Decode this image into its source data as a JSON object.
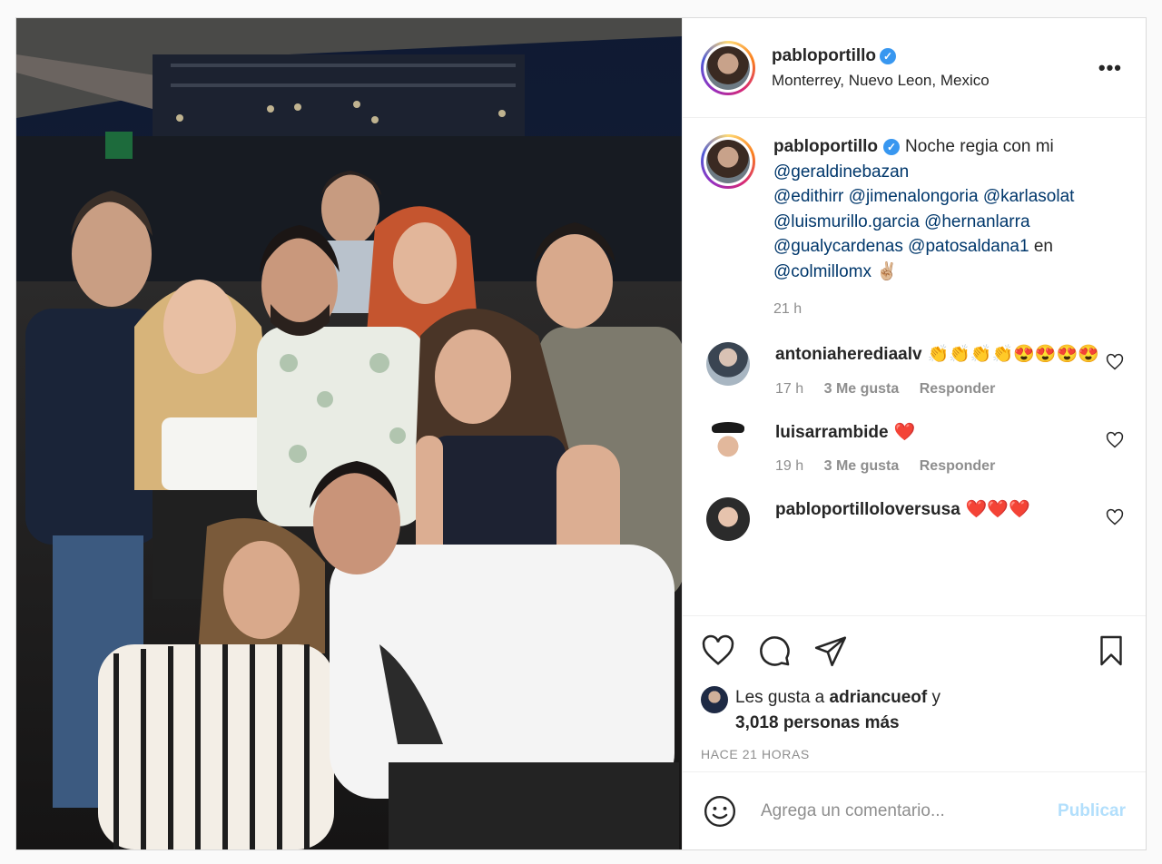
{
  "post": {
    "author": "pabloportillo",
    "location": "Monterrey, Nuevo Leon, Mexico",
    "caption": {
      "text_before": "Noche regia con mi",
      "mentions_line1": "@geraldinebazan",
      "m2": "@edithirr",
      "m3": "@jimenalongoria",
      "m4": "@karlasolat",
      "m5": "@luismurillo.garcia",
      "m6": "@hernanlarra",
      "m7": "@gualycardenas",
      "m8": "@patosaldana1",
      "en": "en",
      "m9": "@colmillomx",
      "emoji": "✌🏼"
    },
    "caption_time": "21 h"
  },
  "comments": [
    {
      "user": "antoniaherediaalv",
      "text": "👏👏👏👏😍😍😍😍",
      "time": "17 h",
      "likes": "3 Me gusta",
      "reply": "Responder"
    },
    {
      "user": "luisarrambide",
      "text": "❤️",
      "time": "19 h",
      "likes": "3 Me gusta",
      "reply": "Responder"
    },
    {
      "user": "pabloportilloloversusa",
      "text": "❤️❤️❤️"
    }
  ],
  "likes": {
    "prefix": "Les gusta a",
    "user": "adriancueof",
    "suffix": "y",
    "count": "3,018 personas más"
  },
  "time_ago": "HACE 21 HORAS",
  "comment_box": {
    "placeholder": "Agrega un comentario...",
    "publish": "Publicar"
  },
  "icons": {
    "more": "more-options-icon",
    "like": "heart-icon",
    "comment": "comment-icon",
    "share": "paper-plane-icon",
    "save": "bookmark-icon",
    "emoji": "smiley-icon",
    "verified": "verified-badge-icon"
  },
  "colors": {
    "mention": "#00376b",
    "verified": "#3897f0",
    "publish_disabled": "#b2dffc",
    "muted": "#8e8e8e"
  }
}
